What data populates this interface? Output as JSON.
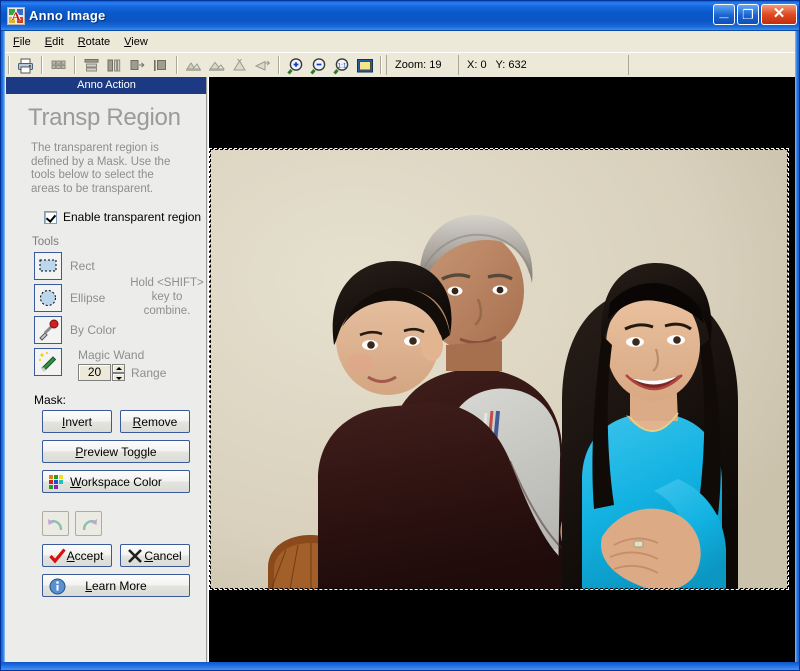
{
  "window": {
    "title": "Anno Image",
    "app_icon": "app-logo-icon",
    "controls": {
      "minimize": "–",
      "maximize": "❐",
      "close": "✕"
    }
  },
  "menubar": {
    "items": [
      {
        "label": "File",
        "accel": "F"
      },
      {
        "label": "Edit",
        "accel": "E"
      },
      {
        "label": "Rotate",
        "accel": "R"
      },
      {
        "label": "View",
        "accel": "V"
      }
    ]
  },
  "toolbar": {
    "buttons": [
      {
        "name": "print-icon",
        "title": "Print"
      },
      {
        "name": "thumbnails-icon",
        "title": "Thumbnails"
      },
      {
        "name": "align-top-icon",
        "title": "Align Top"
      },
      {
        "name": "align-center-icon",
        "title": "Align Center"
      },
      {
        "name": "align-right-icon",
        "title": "Align Right"
      },
      {
        "name": "align-left-icon",
        "title": "Align Left"
      },
      {
        "name": "flip-horizontal-icon",
        "title": "Flip Horizontal"
      },
      {
        "name": "flip-vertical-icon",
        "title": "Flip Vertical"
      },
      {
        "name": "rotate-left-icon",
        "title": "Rotate Left"
      },
      {
        "name": "rotate-right-icon",
        "title": "Rotate Right"
      },
      {
        "name": "zoom-in-icon",
        "title": "Zoom In"
      },
      {
        "name": "zoom-out-icon",
        "title": "Zoom Out"
      },
      {
        "name": "zoom-actual-icon",
        "title": "Actual Size"
      },
      {
        "name": "fit-window-icon",
        "title": "Fit to Window"
      }
    ],
    "status": {
      "zoom_label": "Zoom: 19",
      "coords_label": "X: 0   Y: 632",
      "extra_label": ""
    }
  },
  "sidebar": {
    "header": "Anno Action",
    "title": "Transp Region",
    "description": "The transparent region is defined by a Mask. Use the tools below to select the areas to be transparent.",
    "enable_checkbox": {
      "label": "Enable transparent region",
      "checked": true
    },
    "tools_label": "Tools",
    "tools": [
      {
        "label": "Rect",
        "icon": "rect-select-icon"
      },
      {
        "label": "Ellipse",
        "icon": "ellipse-select-icon"
      },
      {
        "label": "By Color",
        "icon": "eyedropper-icon"
      },
      {
        "label": "Magic Wand",
        "icon": "magic-wand-icon"
      }
    ],
    "hold_note": "Hold <SHIFT> key to combine.",
    "range": {
      "value": "20",
      "label": "Range"
    },
    "mask_label": "Mask:",
    "mask_buttons": [
      {
        "label": "Invert",
        "accel": "I"
      },
      {
        "label": "Remove",
        "accel": "R"
      }
    ],
    "preview_toggle": {
      "label": "Preview Toggle",
      "accel": "P"
    },
    "workspace_color": {
      "label": "Workspace Color",
      "accel": "W",
      "icon": "color-swatch-icon"
    },
    "history": [
      {
        "name": "undo-button",
        "icon": "undo-arrow-icon",
        "enabled": false
      },
      {
        "name": "redo-button",
        "icon": "redo-arrow-icon",
        "enabled": false
      }
    ],
    "accept": {
      "label": "Accept",
      "accel": "A",
      "icon": "check-icon"
    },
    "cancel": {
      "label": "Cancel",
      "accel": "C",
      "icon": "x-icon"
    },
    "learn_more": {
      "label": "Learn More",
      "accel": "L",
      "icon": "info-icon"
    }
  },
  "canvas": {
    "background_color": "#000000",
    "photo": {
      "wall_color": "#ded6c1",
      "selection_active": true,
      "subjects": [
        {
          "name": "man",
          "hair": "#b8b4ad",
          "skin": "#c08e6e",
          "shirt": "#b5b5b0"
        },
        {
          "name": "boy",
          "hair": "#1a1410",
          "skin": "#e0b496",
          "shirt": "#d0d0cc"
        },
        {
          "name": "woman",
          "hair": "#120d0a",
          "skin": "#e6bb9c",
          "shirt": "#1ab6e8"
        }
      ],
      "chair_color": "#8a4a1e",
      "sweater_color": "#2e1412"
    }
  }
}
